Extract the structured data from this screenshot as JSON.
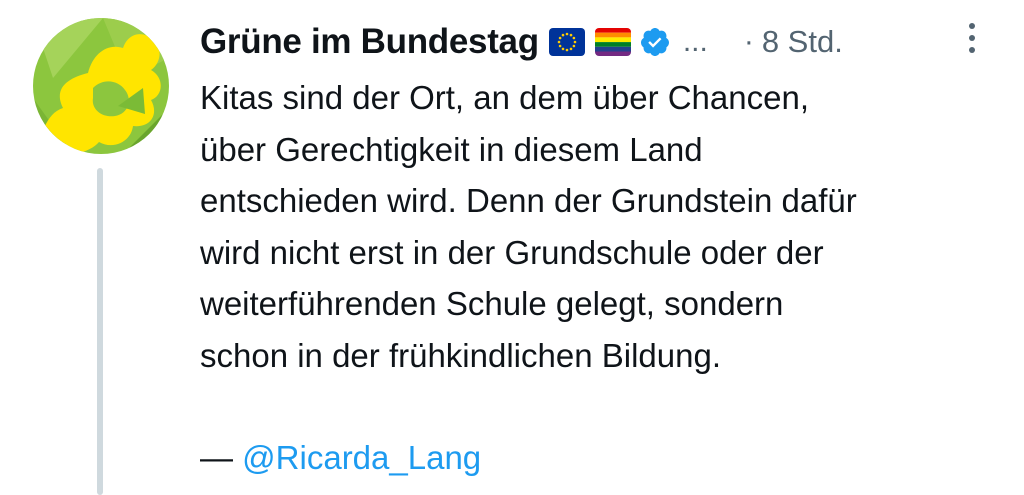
{
  "tweet": {
    "display_name": "Grüne im Bundestag",
    "badges": {
      "eu_flag_icon": "eu-flag-icon",
      "rainbow_flag_icon": "rainbow-flag-icon",
      "verified_icon": "verified-badge-icon"
    },
    "ellipsis": "...",
    "separator": "·",
    "timestamp": "8 Std.",
    "body_lines": [
      "Kitas sind der Ort, an dem über Chancen,",
      "über Gerechtigkeit in diesem Land",
      "entschieden wird. Denn der Grundstein dafür",
      "wird nicht erst in der Grundschule oder der",
      "weiterführenden Schule gelegt, sondern",
      "schon in der frühkindlichen Bildung."
    ],
    "attribution_dash": "—",
    "attribution_handle": "@Ricarda_Lang"
  },
  "colors": {
    "text": "#0f1419",
    "secondary": "#536471",
    "link": "#1d9bf0",
    "thread_line": "#cfd9de",
    "avatar_green": "#8cc63e",
    "avatar_yellow": "#ffe500"
  }
}
